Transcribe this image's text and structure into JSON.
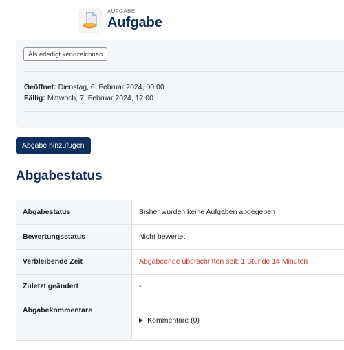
{
  "header": {
    "kicker": "AUFGABE",
    "title": "Aufgabe",
    "icon": "assignment-icon"
  },
  "dates": {
    "mark_done_label": "Als erledigt kennzeichnen",
    "opened_label": "Geöffnet:",
    "opened_value": "Dienstag, 6. Februar 2024, 00:00",
    "due_label": "Fällig:",
    "due_value": "Mittwoch, 7. Februar 2024, 12:00"
  },
  "actions": {
    "add_submission_label": "Abgabe hinzufügen"
  },
  "status": {
    "heading": "Abgabestatus",
    "rows": [
      {
        "label": "Abgabestatus",
        "value": "Bisher wurden keine Aufgaben abgegeben"
      },
      {
        "label": "Bewertungsstatus",
        "value": "Nicht bewertet"
      },
      {
        "label": "Verbleibende Zeit",
        "value": "Abgabeende überschritten seit: 1 Stunde 14 Minuten"
      },
      {
        "label": "Zuletzt geändert",
        "value": "-"
      },
      {
        "label": "Abgabekommentare",
        "value": "Kommentare (0)"
      }
    ]
  },
  "colors": {
    "brand": "#0f2f5c",
    "overdue": "#c0392b"
  }
}
